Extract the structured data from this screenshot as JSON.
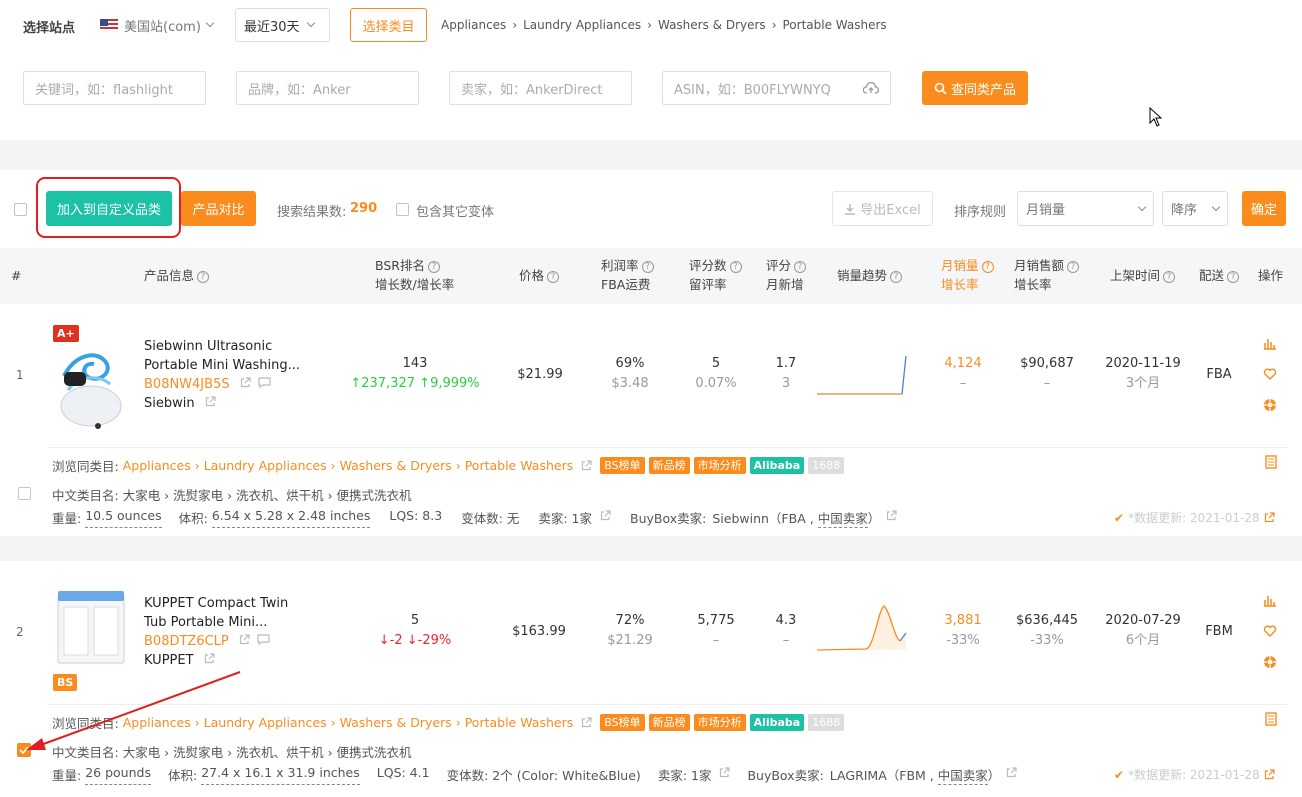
{
  "filters": {
    "site_label": "选择站点",
    "site_value": "美国站(com)",
    "period_value": "最近30天",
    "choose_category_button": "选择类目",
    "breadcrumb": [
      "Appliances",
      "Laundry Appliances",
      "Washers & Dryers",
      "Portable Washers"
    ],
    "keyword_placeholder": "关键词，如：flashlight",
    "brand_placeholder": "品牌，如：Anker",
    "seller_placeholder": "卖家，如：AnkerDirect",
    "asin_placeholder": "ASIN，如：B00FLYWNYQ",
    "search_button": "查同类产品"
  },
  "toolbar": {
    "add_custom_button": "加入到自定义品类",
    "compare_button": "产品对比",
    "result_label": "搜索结果数:",
    "result_count": "290",
    "include_variants_label": "包含其它变体",
    "export_button": "导出Excel",
    "sort_label": "排序规则",
    "sort_value": "月销量",
    "order_value": "降序",
    "confirm_button": "确定"
  },
  "columns": {
    "index": "#",
    "product": "产品信息",
    "bsr_1": "BSR排名",
    "bsr_2": "增长数/增长率",
    "price": "价格",
    "profit_1": "利润率",
    "profit_2": "FBA运费",
    "reviews_1": "评分数",
    "reviews_2": "留评率",
    "rating_1": "评分",
    "rating_2": "月新增",
    "trend": "销量趋势",
    "monthly_sales_1": "月销量",
    "monthly_sales_2": "增长率",
    "monthly_revenue_1": "月销售额",
    "monthly_revenue_2": "增长率",
    "listed": "上架时间",
    "shipping": "配送",
    "actions": "操作"
  },
  "products": [
    {
      "index": "1",
      "badge": "A+",
      "title_1": "Siebwinn Ultrasonic",
      "title_2": "Portable Mini Washing...",
      "asin": "B08NW4JB5S",
      "brand": "Siebwin",
      "bsr": "143",
      "bsr_change": "237,327",
      "bsr_rate": "9,999%",
      "price": "$21.99",
      "profit_rate": "69%",
      "fba_fee": "$3.48",
      "review_count": "5",
      "review_rate": "0.07%",
      "rating": "1.7",
      "rating_new": "3",
      "monthly_sales": "4,124",
      "monthly_sales_growth": "–",
      "monthly_revenue": "$90,687",
      "monthly_revenue_growth": "–",
      "listed_date": "2020-11-19",
      "listed_age": "3个月",
      "shipping": "FBA",
      "browse_label": "浏览同类目:",
      "browse_path": "Appliances › Laundry Appliances › Washers & Dryers › Portable Washers",
      "tags": [
        "BS榜单",
        "新品榜",
        "市场分析",
        "Alibaba",
        "1688"
      ],
      "cn_category_label": "中文类目名:",
      "cn_category": "大家电 › 洗熨家电 › 洗衣机、烘干机 › 便携式洗衣机",
      "weight_label": "重量:",
      "weight": "10.5 ounces",
      "volume_label": "体积:",
      "volume": "6.54 x 5.28 x 2.48 inches",
      "lqs": "LQS: 8.3",
      "variants": "变体数: 无",
      "sellers": "卖家: 1家",
      "buybox_label": "BuyBox卖家:",
      "buybox_seller": "Siebwinn（FBA ,",
      "buybox_region": "中国卖家",
      "buybox_close": "）",
      "updated": "*数据更新: 2021-01-28"
    },
    {
      "index": "2",
      "badge": "BS",
      "title_1": "KUPPET Compact Twin",
      "title_2": "Tub Portable Mini...",
      "asin": "B08DTZ6CLP",
      "brand": "KUPPET",
      "bsr": "5",
      "bsr_change": "-2",
      "bsr_rate": "-29%",
      "price": "$163.99",
      "profit_rate": "72%",
      "fba_fee": "$21.29",
      "review_count": "5,775",
      "review_rate": "–",
      "rating": "4.3",
      "rating_new": "–",
      "monthly_sales": "3,881",
      "monthly_sales_growth": "-33%",
      "monthly_revenue": "$636,445",
      "monthly_revenue_growth": "-33%",
      "listed_date": "2020-07-29",
      "listed_age": "6个月",
      "shipping": "FBM",
      "browse_label": "浏览同类目:",
      "browse_path": "Appliances › Laundry Appliances › Washers & Dryers › Portable Washers",
      "tags": [
        "BS榜单",
        "新品榜",
        "市场分析",
        "Alibaba",
        "1688"
      ],
      "cn_category_label": "中文类目名:",
      "cn_category": "大家电 › 洗熨家电 › 洗衣机、烘干机 › 便携式洗衣机",
      "weight_label": "重量:",
      "weight": "26 pounds",
      "volume_label": "体积:",
      "volume": "27.4 x 16.1 x 31.9 inches",
      "lqs": "LQS: 4.1",
      "variants": "变体数: 2个 (Color: White&Blue)",
      "sellers": "卖家: 1家",
      "buybox_label": "BuyBox卖家:",
      "buybox_seller": "LAGRIMA（FBM ,",
      "buybox_region": "中国卖家",
      "buybox_close": "）",
      "updated": "*数据更新: 2021-01-28"
    }
  ],
  "colors": {
    "accent": "#fa8c1e",
    "teal": "#1cc1a6",
    "highlight": "#e02020",
    "green": "#2ecc40",
    "red": "#f5222d"
  }
}
